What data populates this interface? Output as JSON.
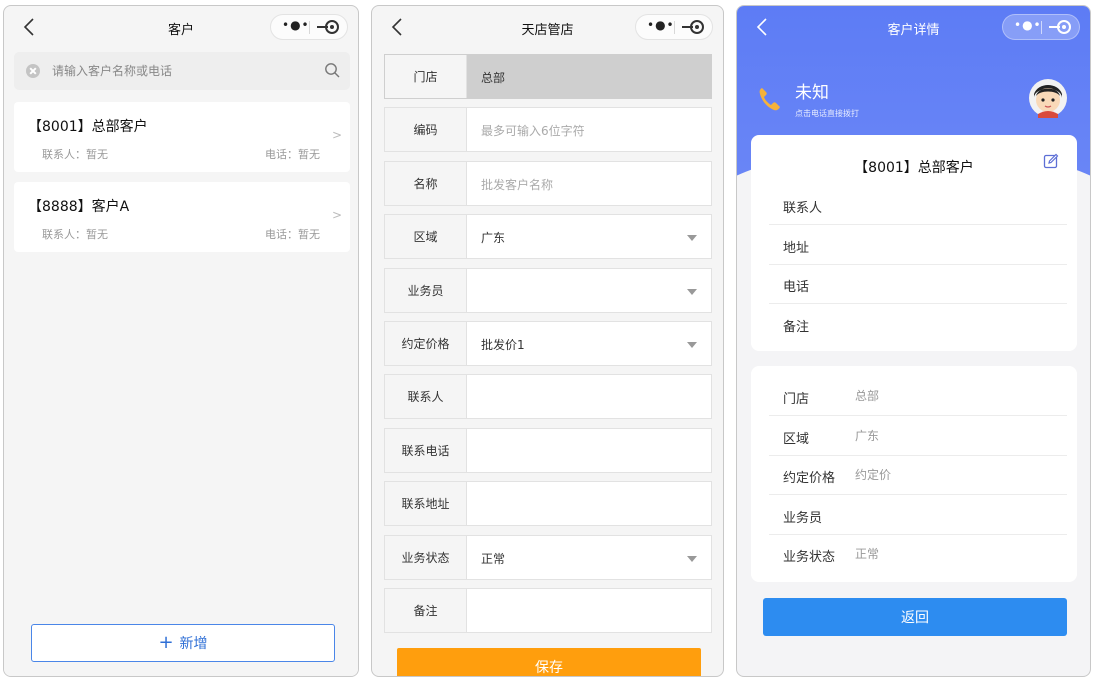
{
  "customers_page": {
    "title": "客户",
    "search_placeholder": "请输入客户名称或电话",
    "customers": [
      {
        "name": "【8001】总部客户",
        "contact": "联系人：暂无",
        "phone": "电话：暂无"
      },
      {
        "name": "【8888】客户A",
        "contact": "联系人：暂无",
        "phone": "电话：暂无"
      }
    ],
    "add_label": "新增",
    "add_icon": "plus-icon"
  },
  "form_page": {
    "title": "天店管店",
    "fields": [
      {
        "label": "门店",
        "value": "总部",
        "placeholder": "",
        "dropdown": false,
        "disabled": true
      },
      {
        "label": "编码",
        "value": "",
        "placeholder": "最多可输入6位字符",
        "dropdown": false,
        "disabled": false
      },
      {
        "label": "名称",
        "value": "",
        "placeholder": "批发客户名称",
        "dropdown": false,
        "disabled": false
      },
      {
        "label": "区域",
        "value": "广东",
        "placeholder": "",
        "dropdown": true,
        "disabled": false
      },
      {
        "label": "业务员",
        "value": "",
        "placeholder": "",
        "dropdown": true,
        "disabled": false
      },
      {
        "label": "约定价格",
        "value": "批发价1",
        "placeholder": "",
        "dropdown": true,
        "disabled": false
      },
      {
        "label": "联系人",
        "value": "",
        "placeholder": "",
        "dropdown": false,
        "disabled": false
      },
      {
        "label": "联系电话",
        "value": "",
        "placeholder": "",
        "dropdown": false,
        "disabled": false
      },
      {
        "label": "联系地址",
        "value": "",
        "placeholder": "",
        "dropdown": false,
        "disabled": false
      },
      {
        "label": "业务状态",
        "value": "正常",
        "placeholder": "",
        "dropdown": true,
        "disabled": false
      },
      {
        "label": "备注",
        "value": "",
        "placeholder": "",
        "dropdown": false,
        "disabled": false
      }
    ],
    "save_label": "保存"
  },
  "detail_page": {
    "title": "客户详情",
    "contact_name": "未知",
    "call_hint": "点击电话直接拨打",
    "card_title": "【8001】总部客户",
    "card1_rows": [
      {
        "key": "联系人",
        "value": ""
      },
      {
        "key": "地址",
        "value": ""
      },
      {
        "key": "电话",
        "value": ""
      },
      {
        "key": "备注",
        "value": ""
      }
    ],
    "card2_rows": [
      {
        "key": "门店",
        "value": "总部"
      },
      {
        "key": "区域",
        "value": "广东"
      },
      {
        "key": "约定价格",
        "value": "约定价"
      },
      {
        "key": "业务员",
        "value": ""
      },
      {
        "key": "业务状态",
        "value": "正常"
      }
    ],
    "back_label": "返回"
  },
  "colors": {
    "accent_blue": "#2d8cf0",
    "header_blue": "#5d7cf5",
    "save_orange": "#ff9e0d",
    "phone_icon": "#f6b23a"
  }
}
